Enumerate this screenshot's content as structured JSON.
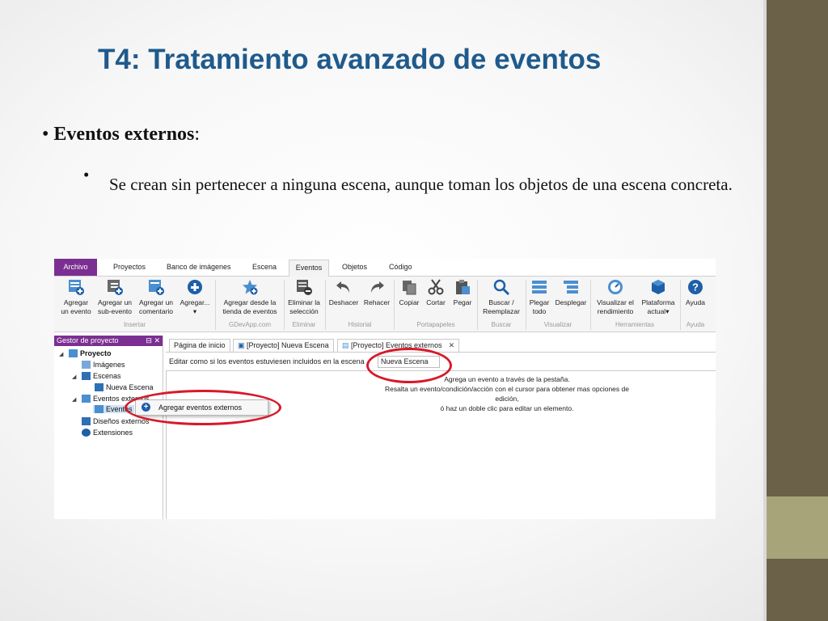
{
  "slide": {
    "title": "T4: Tratamiento avanzado de eventos",
    "bullet1_bold": "Eventos externos",
    "bullet1_rest": ":",
    "bullet2": "Se crean sin pertenecer a ninguna escena, aunque toman los objetos de una escena concreta.",
    "colors": {
      "title": "#1f5a8c",
      "sidebar": "#6b6148",
      "sidebar_accent": "#a8a47a",
      "menu_accent": "#7b2f92",
      "highlight": "#d7192a"
    }
  },
  "menu": {
    "archivo": "Archivo",
    "items": [
      "Proyectos",
      "Banco de imágenes",
      "Escena",
      "Eventos",
      "Objetos",
      "Código"
    ]
  },
  "ribbon": {
    "buttons": [
      {
        "l1": "Agregar",
        "l2": "un evento",
        "icon": "add-event-icon"
      },
      {
        "l1": "Agregar un",
        "l2": "sub-evento",
        "icon": "add-subevent-icon"
      },
      {
        "l1": "Agregar un",
        "l2": "comentario",
        "icon": "add-comment-icon"
      },
      {
        "l1": "Agregar...",
        "l2": "▾",
        "icon": "add-more-icon"
      },
      {
        "l1": "Agregar desde la",
        "l2": "tienda de eventos",
        "icon": "event-store-icon"
      },
      {
        "l1": "Eliminar la",
        "l2": "selección",
        "icon": "delete-selection-icon"
      },
      {
        "l1": "Deshacer",
        "l2": "",
        "icon": "undo-icon"
      },
      {
        "l1": "Rehacer",
        "l2": "",
        "icon": "redo-icon"
      },
      {
        "l1": "Copiar",
        "l2": "",
        "icon": "copy-icon"
      },
      {
        "l1": "Cortar",
        "l2": "",
        "icon": "cut-icon"
      },
      {
        "l1": "Pegar",
        "l2": "",
        "icon": "paste-icon"
      },
      {
        "l1": "Buscar /",
        "l2": "Reemplazar",
        "icon": "search-replace-icon"
      },
      {
        "l1": "Plegar",
        "l2": "todo",
        "icon": "fold-all-icon"
      },
      {
        "l1": "Desplegar",
        "l2": "",
        "icon": "unfold-icon"
      },
      {
        "l1": "Visualizar el",
        "l2": "rendimiento",
        "icon": "performance-icon"
      },
      {
        "l1": "Plataforma",
        "l2": "actual▾",
        "icon": "platform-icon"
      },
      {
        "l1": "Ayuda",
        "l2": "",
        "icon": "help-icon"
      }
    ],
    "groups": [
      "Insertar",
      "GDevApp.com",
      "Eliminar",
      "Historial",
      "Portapapeles",
      "Buscar",
      "Visualizar",
      "Herramientas",
      "Ayuda"
    ]
  },
  "panel": {
    "title": "Gestor de proyecto",
    "buttons": "⊟ ✕",
    "tree": [
      "Proyecto",
      "Imágenes",
      "Escenas",
      "Nueva Escena",
      "Eventos externos",
      "Eventos",
      "Diseños externos",
      "Extensiones"
    ]
  },
  "context_menu": {
    "label": "Agregar eventos externos"
  },
  "tabs": [
    "Página de inicio",
    "[Proyecto] Nueva Escena",
    "[Proyecto] Eventos externos"
  ],
  "tab_close": "✕",
  "subbar": {
    "text": "Editar como si los eventos estuviesen incluidos en la escena",
    "scene": "Nueva Escena"
  },
  "hint": {
    "line1": "Agrega un evento a través de la pestaña.",
    "line2": "Resalta un evento/condición/acción con el cursor para obtener mas opciones de edición,",
    "line3": "ó haz un doble clic para editar un elemento."
  }
}
